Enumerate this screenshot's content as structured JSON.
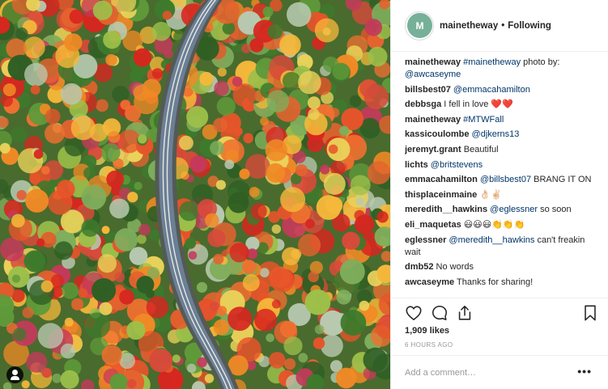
{
  "header": {
    "avatar_initials": "M",
    "username": "mainetheway",
    "separator": "•",
    "follow_status": "Following"
  },
  "comments": [
    {
      "user": "mainetheway",
      "text": "",
      "mention": "#mainetheway",
      "after": " photo by: ",
      "mention2": "@awcaseyme"
    },
    {
      "user": "billsbest07",
      "text": "",
      "mention": "@emmacahamilton",
      "after": "",
      "mention2": ""
    },
    {
      "user": "debbsga",
      "text": "I fell in love ❤️❤️",
      "mention": "",
      "after": "",
      "mention2": ""
    },
    {
      "user": "mainetheway",
      "text": "",
      "mention": "#MTWFall",
      "after": "",
      "mention2": ""
    },
    {
      "user": "kassicoulombe",
      "text": "",
      "mention": "@djkerns13",
      "after": "",
      "mention2": ""
    },
    {
      "user": "jeremyt.grant",
      "text": "Beautiful",
      "mention": "",
      "after": "",
      "mention2": ""
    },
    {
      "user": "lichts",
      "text": "",
      "mention": "@britstevens",
      "after": "",
      "mention2": ""
    },
    {
      "user": "emmacahamilton",
      "text": "",
      "mention": "@billsbest07",
      "after": " BRANG IT ON",
      "mention2": ""
    },
    {
      "user": "thisplaceinmaine",
      "text": "👌🏻✌🏻",
      "mention": "",
      "after": "",
      "mention2": ""
    },
    {
      "user": "meredith__hawkins",
      "text": "",
      "mention": "@eglessner",
      "after": " so soon",
      "mention2": ""
    },
    {
      "user": "eli_maquetas",
      "text": "😃😃😃👏👏👏",
      "mention": "",
      "after": "",
      "mention2": ""
    },
    {
      "user": "eglessner",
      "text": "",
      "mention": "@meredith__hawkins",
      "after": " can't freakin wait",
      "mention2": ""
    },
    {
      "user": "dmb52",
      "text": "No words",
      "mention": "",
      "after": "",
      "mention2": ""
    },
    {
      "user": "awcaseyme",
      "text": "Thanks for sharing!",
      "mention": "",
      "after": "",
      "mention2": ""
    }
  ],
  "actions": {
    "like_icon": "heart-icon",
    "comment_icon": "comment-bubble-icon",
    "share_icon": "share-icon",
    "save_icon": "bookmark-icon"
  },
  "likes_text": "1,909 likes",
  "timestamp": "6 HOURS AGO",
  "add_comment": {
    "placeholder": "Add a comment…",
    "more_label": "•••"
  },
  "colors": {
    "accent_link": "#003569",
    "avatar_bg": "#76b098",
    "road": "#6b7f96"
  }
}
